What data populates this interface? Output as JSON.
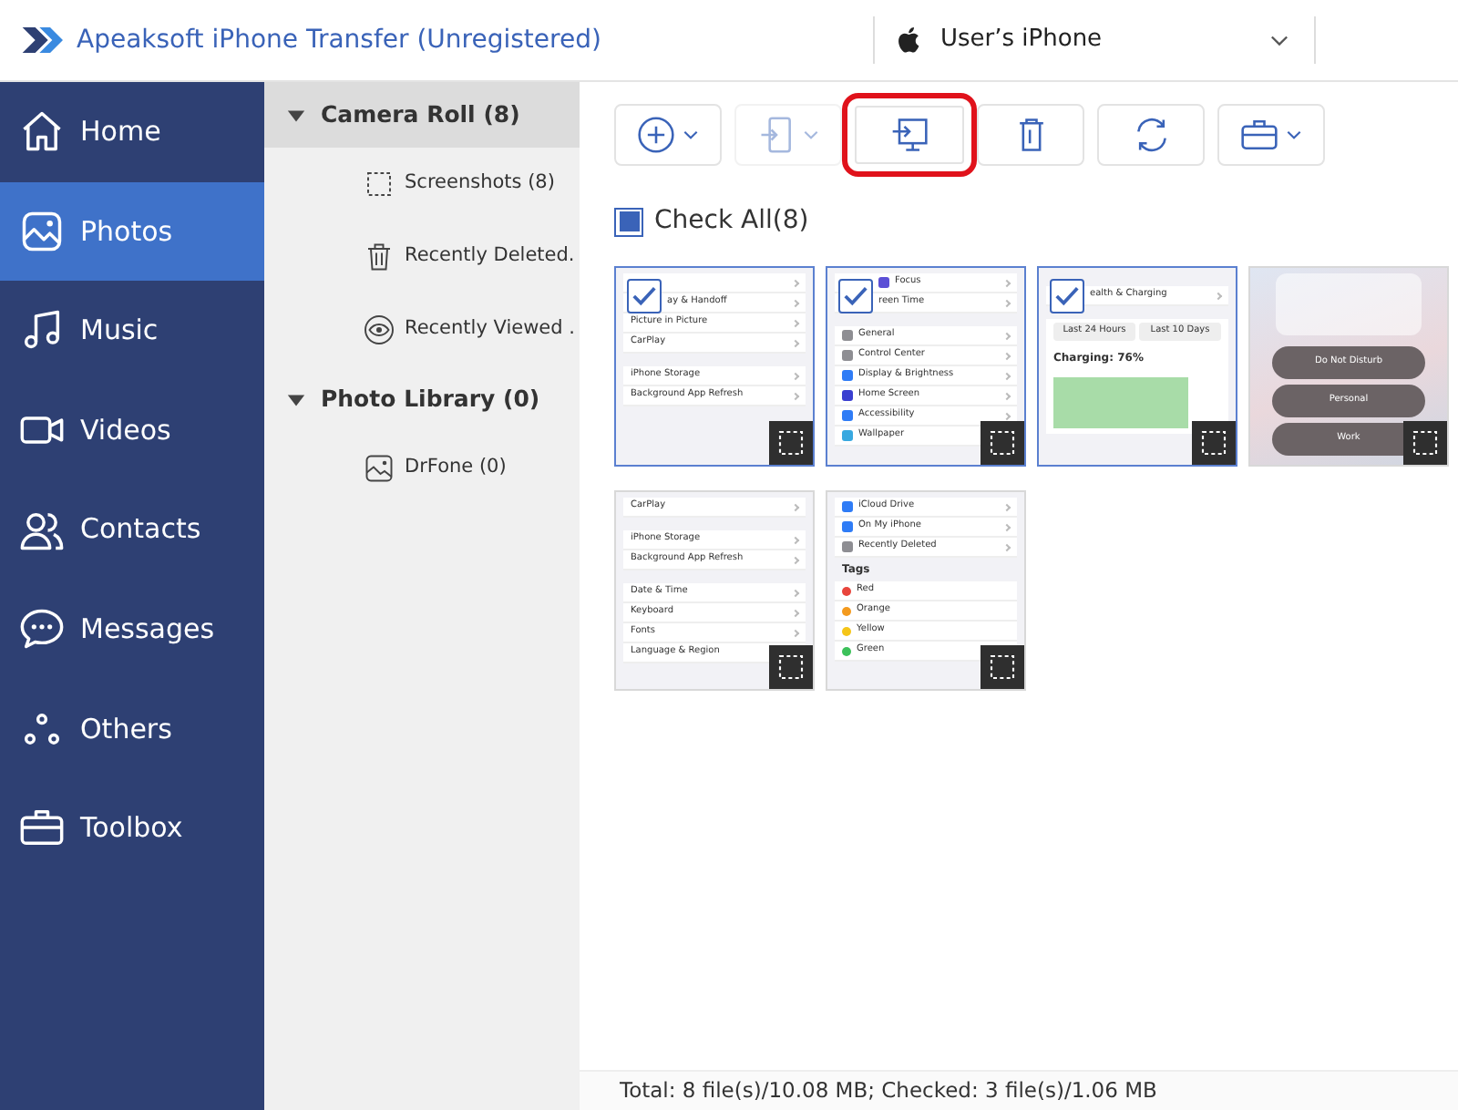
{
  "titlebar": {
    "title": "Apeaksoft iPhone Transfer (Unregistered)",
    "device": "User’s iPhone"
  },
  "sidebar": {
    "items": [
      {
        "kind": "home",
        "label": "Home",
        "selected": false
      },
      {
        "kind": "photos",
        "label": "Photos",
        "selected": true
      },
      {
        "kind": "music",
        "label": "Music",
        "selected": false
      },
      {
        "kind": "videos",
        "label": "Videos",
        "selected": false
      },
      {
        "kind": "contacts",
        "label": "Contacts",
        "selected": false
      },
      {
        "kind": "messages",
        "label": "Messages",
        "selected": false
      },
      {
        "kind": "others",
        "label": "Others",
        "selected": false
      },
      {
        "kind": "toolbox",
        "label": "Toolbox",
        "selected": false
      }
    ]
  },
  "tree": [
    {
      "label": "Camera Roll (8)",
      "expanded": true,
      "selected": true,
      "children": [
        {
          "kind": "screenshot",
          "label": "Screenshots (8)"
        },
        {
          "kind": "trash",
          "label": "Recently Deleted."
        },
        {
          "kind": "eye",
          "label": "Recently Viewed ."
        }
      ]
    },
    {
      "label": "Photo Library (0)",
      "expanded": true,
      "selected": false,
      "children": [
        {
          "kind": "album",
          "label": "DrFone (0)"
        }
      ]
    }
  ],
  "toolbar": [
    {
      "kind": "add",
      "caret": true,
      "disabled": false,
      "highlighted": false
    },
    {
      "kind": "to-device",
      "caret": true,
      "disabled": true,
      "highlighted": false
    },
    {
      "kind": "to-pc",
      "caret": false,
      "disabled": false,
      "highlighted": true
    },
    {
      "kind": "delete",
      "caret": false,
      "disabled": false,
      "highlighted": false
    },
    {
      "kind": "refresh",
      "caret": false,
      "disabled": false,
      "highlighted": false
    },
    {
      "kind": "toolbox",
      "caret": true,
      "disabled": false,
      "highlighted": false
    }
  ],
  "check_all": {
    "label": "Check All(8)",
    "indeterminate": true
  },
  "thumbnails": [
    {
      "kind": "settings",
      "checked": true,
      "rows": [
        {
          "kind": "row",
          "text": ""
        },
        {
          "kind": "row",
          "text": "ay & Handoff"
        },
        {
          "kind": "row",
          "text": "Picture in Picture"
        },
        {
          "kind": "row",
          "text": "CarPlay"
        },
        {
          "kind": "gap"
        },
        {
          "kind": "row",
          "text": "iPhone Storage"
        },
        {
          "kind": "row",
          "text": "Background App Refresh"
        }
      ]
    },
    {
      "kind": "settings",
      "checked": true,
      "rows": [
        {
          "kind": "row",
          "text": "Focus",
          "color": "#5b4fd6"
        },
        {
          "kind": "row",
          "text": "reen Time"
        },
        {
          "kind": "gap"
        },
        {
          "kind": "row",
          "text": "General",
          "color": "#8e8e93"
        },
        {
          "kind": "row",
          "text": "Control Center",
          "color": "#8e8e93"
        },
        {
          "kind": "row",
          "text": "Display & Brightness",
          "color": "#2f7cf6"
        },
        {
          "kind": "row",
          "text": "Home Screen",
          "color": "#3a3fd0"
        },
        {
          "kind": "row",
          "text": "Accessibility",
          "color": "#2f7cf6"
        },
        {
          "kind": "row",
          "text": "Wallpaper",
          "color": "#38a8e0"
        }
      ]
    },
    {
      "kind": "settings",
      "checked": true,
      "rows": [
        {
          "kind": "gap"
        },
        {
          "kind": "row",
          "text": "ealth & Charging"
        },
        {
          "kind": "gap"
        },
        {
          "kind": "segment",
          "text": "Last 24 Hours",
          "text2": "Last 10 Days"
        },
        {
          "kind": "label",
          "text": "Charging: 76%"
        },
        {
          "kind": "chart"
        }
      ]
    },
    {
      "kind": "focus",
      "checked": false,
      "rows": [
        {
          "kind": "note"
        },
        {
          "kind": "pill",
          "text": "Do Not Disturb"
        },
        {
          "kind": "pill",
          "text": "Personal"
        },
        {
          "kind": "pill",
          "text": "Work"
        }
      ]
    },
    {
      "kind": "settings",
      "checked": false,
      "rows": [
        {
          "kind": "row",
          "text": "CarPlay"
        },
        {
          "kind": "gap"
        },
        {
          "kind": "row",
          "text": "iPhone Storage"
        },
        {
          "kind": "row",
          "text": "Background App Refresh"
        },
        {
          "kind": "gap"
        },
        {
          "kind": "row",
          "text": "Date & Time"
        },
        {
          "kind": "row",
          "text": "Keyboard"
        },
        {
          "kind": "row",
          "text": "Fonts"
        },
        {
          "kind": "row",
          "text": "Language & Region"
        }
      ]
    },
    {
      "kind": "settings",
      "checked": false,
      "rows": [
        {
          "kind": "row",
          "text": "iCloud Drive",
          "color": "#2f7cf6"
        },
        {
          "kind": "row",
          "text": "On My iPhone",
          "color": "#2f7cf6"
        },
        {
          "kind": "row",
          "text": "Recently Deleted",
          "color": "#8e8e93"
        },
        {
          "kind": "header",
          "text": "Tags"
        },
        {
          "kind": "tag",
          "text": "Red",
          "color": "#e8453c"
        },
        {
          "kind": "tag",
          "text": "Orange",
          "color": "#f39a1e"
        },
        {
          "kind": "tag",
          "text": "Yellow",
          "color": "#f5c518"
        },
        {
          "kind": "tag",
          "text": "Green",
          "color": "#3cc15a"
        }
      ]
    }
  ],
  "status_bar": "Total: 8 file(s)/10.08 MB; Checked: 3 file(s)/1.06 MB"
}
